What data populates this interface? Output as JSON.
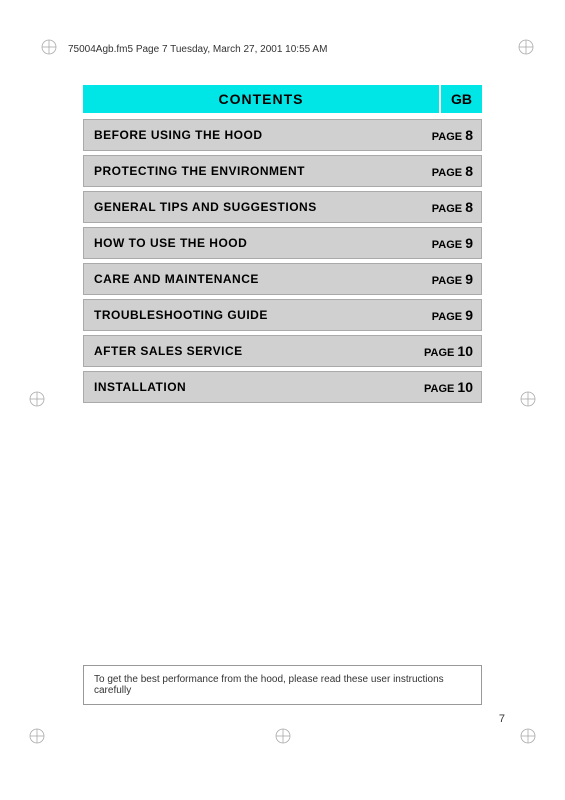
{
  "header": {
    "filename": "75004Agb.fm5  Page 7  Tuesday, March 27, 2001  10:55 AM"
  },
  "contents": {
    "title": "CONTENTS",
    "gb_label": "GB",
    "rows": [
      {
        "label": "BEFORE USING THE HOOD",
        "page_prefix": "PAGE",
        "page_num": "8"
      },
      {
        "label": "PROTECTING THE ENVIRONMENT",
        "page_prefix": "PAGE",
        "page_num": "8"
      },
      {
        "label": "GENERAL TIPS AND SUGGESTIONS",
        "page_prefix": "PAGE",
        "page_num": "8"
      },
      {
        "label": "HOW TO USE THE HOOD",
        "page_prefix": "PAGE",
        "page_num": "9"
      },
      {
        "label": "CARE AND MAINTENANCE",
        "page_prefix": "PAGE",
        "page_num": "9"
      },
      {
        "label": "TROUBLESHOOTING GUIDE",
        "page_prefix": "PAGE",
        "page_num": "9"
      },
      {
        "label": "AFTER SALES SERVICE",
        "page_prefix": "PAGE",
        "page_num": "10"
      },
      {
        "label": "INSTALLATION",
        "page_prefix": "PAGE",
        "page_num": "10"
      }
    ]
  },
  "footer": {
    "note": "To get the best performance from the hood, please read these user instructions carefully"
  },
  "page_number": "7"
}
